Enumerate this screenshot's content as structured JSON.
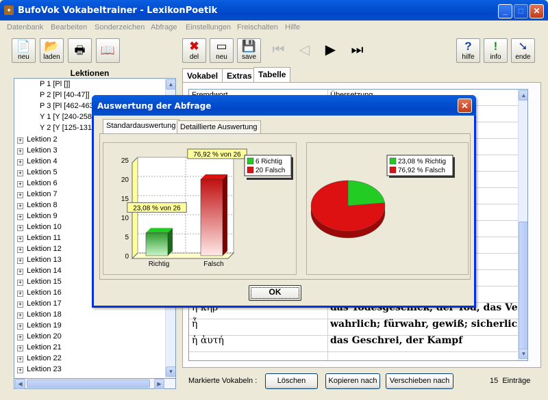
{
  "window": {
    "title": "BufoVok Vokabeltrainer - LexikonPoetik"
  },
  "menu": [
    "Datenbank",
    "Bearbeiten",
    "Sonderzeichen",
    "Abfrage",
    "Einstellungen",
    "Freischalten",
    "Hilfe"
  ],
  "toolbar": {
    "neu": "neu",
    "laden": "laden",
    "del": "del",
    "neu2": "neu",
    "save": "save",
    "hilfe": "hilfe",
    "info": "info",
    "ende": "ende"
  },
  "lektionen": {
    "header": "Lektionen",
    "sub_items": [
      "P 1 [Pl []]",
      "P 2 [Pl [40-47]]",
      "P 3 [Pl [462-463",
      "Y 1 [Y [240-258",
      "Y 2 [Y [125-131"
    ],
    "items": [
      "Lektion 2",
      "Lektion 3",
      "Lektion 4",
      "Lektion 5",
      "Lektion 6",
      "Lektion 7",
      "Lektion 8",
      "Lektion 9",
      "Lektion 10",
      "Lektion 11",
      "Lektion 12",
      "Lektion 13",
      "Lektion 14",
      "Lektion 15",
      "Lektion 16",
      "Lektion 17",
      "Lektion 18",
      "Lektion 19",
      "Lektion 20",
      "Lektion 21",
      "Lektion 22",
      "Lektion 23"
    ]
  },
  "tabs": {
    "vokabel": "Vokabel",
    "extras": "Extras",
    "tabelle": "Tabelle"
  },
  "grid": {
    "headers": [
      "Fremdwort",
      "Übersetzung"
    ],
    "rows": [
      {
        "greek": "ἡ κῆρ",
        "german": "das Todesgeschick, der Tod, das Verhäng"
      },
      {
        "greek": "ἦ",
        "german": "wahrlich; fürwahr, gewiß; sicherlich"
      },
      {
        "greek": "ἡ ἀυτή",
        "german": "das Geschrei, der Kampf"
      }
    ]
  },
  "bottom": {
    "marked_label": "Markierte Vokabeln :",
    "delete": "Löschen",
    "copy": "Kopieren nach",
    "move": "Verschieben nach",
    "count": "15  Einträge"
  },
  "dialog": {
    "title": "Auswertung der Abfrage",
    "tab_standard": "Standardauswertung",
    "tab_detail": "Detaillierte Auswertung",
    "ok": "OK"
  },
  "chart_data": [
    {
      "type": "bar",
      "categories": [
        "Richtig",
        "Falsch"
      ],
      "values": [
        6,
        20
      ],
      "ylim": [
        0,
        25
      ],
      "yticks": [
        0,
        5,
        10,
        15,
        20,
        25
      ],
      "annotations": [
        "23,08 % von 26",
        "76,92 % von 26"
      ],
      "legend": [
        "6 Richtig",
        "20 Falsch"
      ],
      "colors": [
        "#22cc22",
        "#dd1111"
      ],
      "grid": true,
      "legend_position": "top-right"
    },
    {
      "type": "pie",
      "labels": [
        "23,08 % Richtig",
        "76,92 % Falsch"
      ],
      "values": [
        23.08,
        76.92
      ],
      "colors": [
        "#22cc22",
        "#dd1111"
      ],
      "legend_position": "top-right"
    }
  ],
  "colors": {
    "accent": "#0a5fe0",
    "correct": "#22cc22",
    "wrong": "#dd1111"
  }
}
